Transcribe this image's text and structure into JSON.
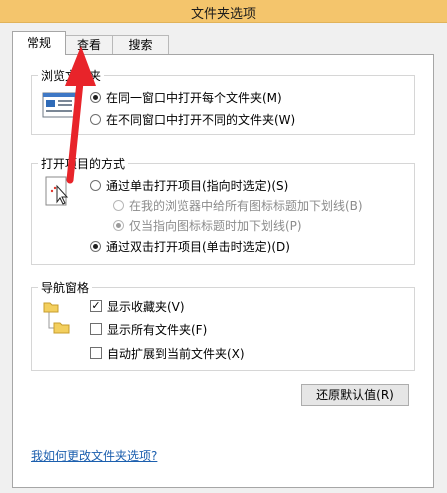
{
  "window": {
    "title": "文件夹选项"
  },
  "tabs": [
    {
      "label": "常规",
      "active": true
    },
    {
      "label": "查看",
      "active": false
    },
    {
      "label": "搜索",
      "active": false
    }
  ],
  "browse_folders": {
    "legend": "浏览文件夹",
    "options": [
      {
        "label": "在同一窗口中打开每个文件夹(M)",
        "checked": true
      },
      {
        "label": "在不同窗口中打开不同的文件夹(W)",
        "checked": false
      }
    ]
  },
  "click_items": {
    "legend": "打开项目的方式",
    "options": [
      {
        "label": "通过单击打开项目(指向时选定)(S)",
        "checked": false,
        "enabled": true
      },
      {
        "label": "在我的浏览器中给所有图标标题加下划线(B)",
        "checked": false,
        "enabled": false
      },
      {
        "label": "仅当指向图标标题时加下划线(P)",
        "checked": true,
        "enabled": false
      },
      {
        "label": "通过双击打开项目(单击时选定)(D)",
        "checked": true,
        "enabled": true
      }
    ]
  },
  "navigation_pane": {
    "legend": "导航窗格",
    "options": [
      {
        "label": "显示收藏夹(V)",
        "checked": true
      },
      {
        "label": "显示所有文件夹(F)",
        "checked": false
      },
      {
        "label": "自动扩展到当前文件夹(X)",
        "checked": false
      }
    ]
  },
  "restore_button": {
    "label": "还原默认值(R)"
  },
  "help_link": {
    "label": "我如何更改文件夹选项?"
  },
  "colors": {
    "titlebar": "#f4c56c",
    "arrow": "#e8242a",
    "link": "#1c5fae"
  },
  "icons": [
    "folder-window-icon",
    "cursor-click-icon",
    "folder-tree-icon",
    "red-arrow-annotation"
  ]
}
